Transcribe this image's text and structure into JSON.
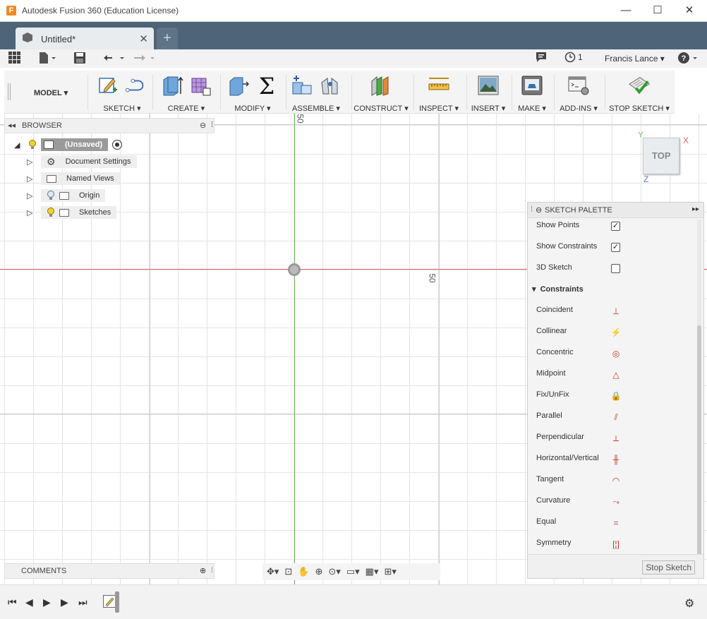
{
  "window": {
    "title": "Autodesk Fusion 360 (Education License)",
    "minimize": "—",
    "maximize": "☐",
    "close": "✕"
  },
  "tabs": {
    "document": "Untitled*",
    "close": "✕",
    "new": "+"
  },
  "quick_access": {
    "user": "Francis Lance ▾",
    "jobs_count": "1",
    "help": "?"
  },
  "toolbar": {
    "workspace": "MODEL ▾",
    "groups": [
      {
        "label": "SKETCH ▾"
      },
      {
        "label": "CREATE ▾"
      },
      {
        "label": "MODIFY ▾"
      },
      {
        "label": "ASSEMBLE ▾"
      },
      {
        "label": "CONSTRUCT ▾"
      },
      {
        "label": "INSPECT ▾"
      },
      {
        "label": "INSERT ▾"
      },
      {
        "label": "MAKE ▾"
      },
      {
        "label": "ADD-INS ▾"
      },
      {
        "label": "STOP SKETCH ▾"
      }
    ]
  },
  "browser": {
    "title": "BROWSER",
    "root": "(Unsaved)",
    "items": [
      {
        "label": "Document Settings"
      },
      {
        "label": "Named Views"
      },
      {
        "label": "Origin"
      },
      {
        "label": "Sketches"
      }
    ]
  },
  "canvas": {
    "dim_top": "50",
    "dim_right": "50"
  },
  "viewcube": {
    "face": "TOP",
    "x": "X",
    "y": "Y",
    "z": "Z"
  },
  "palette": {
    "title": "SKETCH PALETTE",
    "options": [
      {
        "label": "Show Points",
        "checked": "✓"
      },
      {
        "label": "Show Constraints",
        "checked": "✓"
      },
      {
        "label": "3D Sketch",
        "checked": ""
      }
    ],
    "section": "Constraints",
    "constraints": [
      {
        "label": "Coincident",
        "icon": "coincident-icon",
        "glyph": "⊥"
      },
      {
        "label": "Collinear",
        "icon": "collinear-icon",
        "glyph": "⚡"
      },
      {
        "label": "Concentric",
        "icon": "concentric-icon",
        "glyph": "◎"
      },
      {
        "label": "Midpoint",
        "icon": "midpoint-icon",
        "glyph": "△"
      },
      {
        "label": "Fix/UnFix",
        "icon": "lock-icon",
        "glyph": "🔒"
      },
      {
        "label": "Parallel",
        "icon": "parallel-icon",
        "glyph": "⫽"
      },
      {
        "label": "Perpendicular",
        "icon": "perpendicular-icon",
        "glyph": "⟂"
      },
      {
        "label": "Horizontal/Vertical",
        "icon": "horizontal-vertical-icon",
        "glyph": "╫"
      },
      {
        "label": "Tangent",
        "icon": "tangent-icon",
        "glyph": "◠"
      },
      {
        "label": "Curvature",
        "icon": "curvature-icon",
        "glyph": "⤳"
      },
      {
        "label": "Equal",
        "icon": "equal-icon",
        "glyph": "="
      },
      {
        "label": "Symmetry",
        "icon": "symmetry-icon",
        "glyph": "[¦]"
      }
    ],
    "stop_button": "Stop Sketch"
  },
  "comments": {
    "title": "COMMENTS"
  },
  "colors": {
    "tabbar": "#4e6478",
    "x_axis": "#e06060",
    "y_axis": "#6fbf5e",
    "constraint_icon": "#c0392b"
  }
}
